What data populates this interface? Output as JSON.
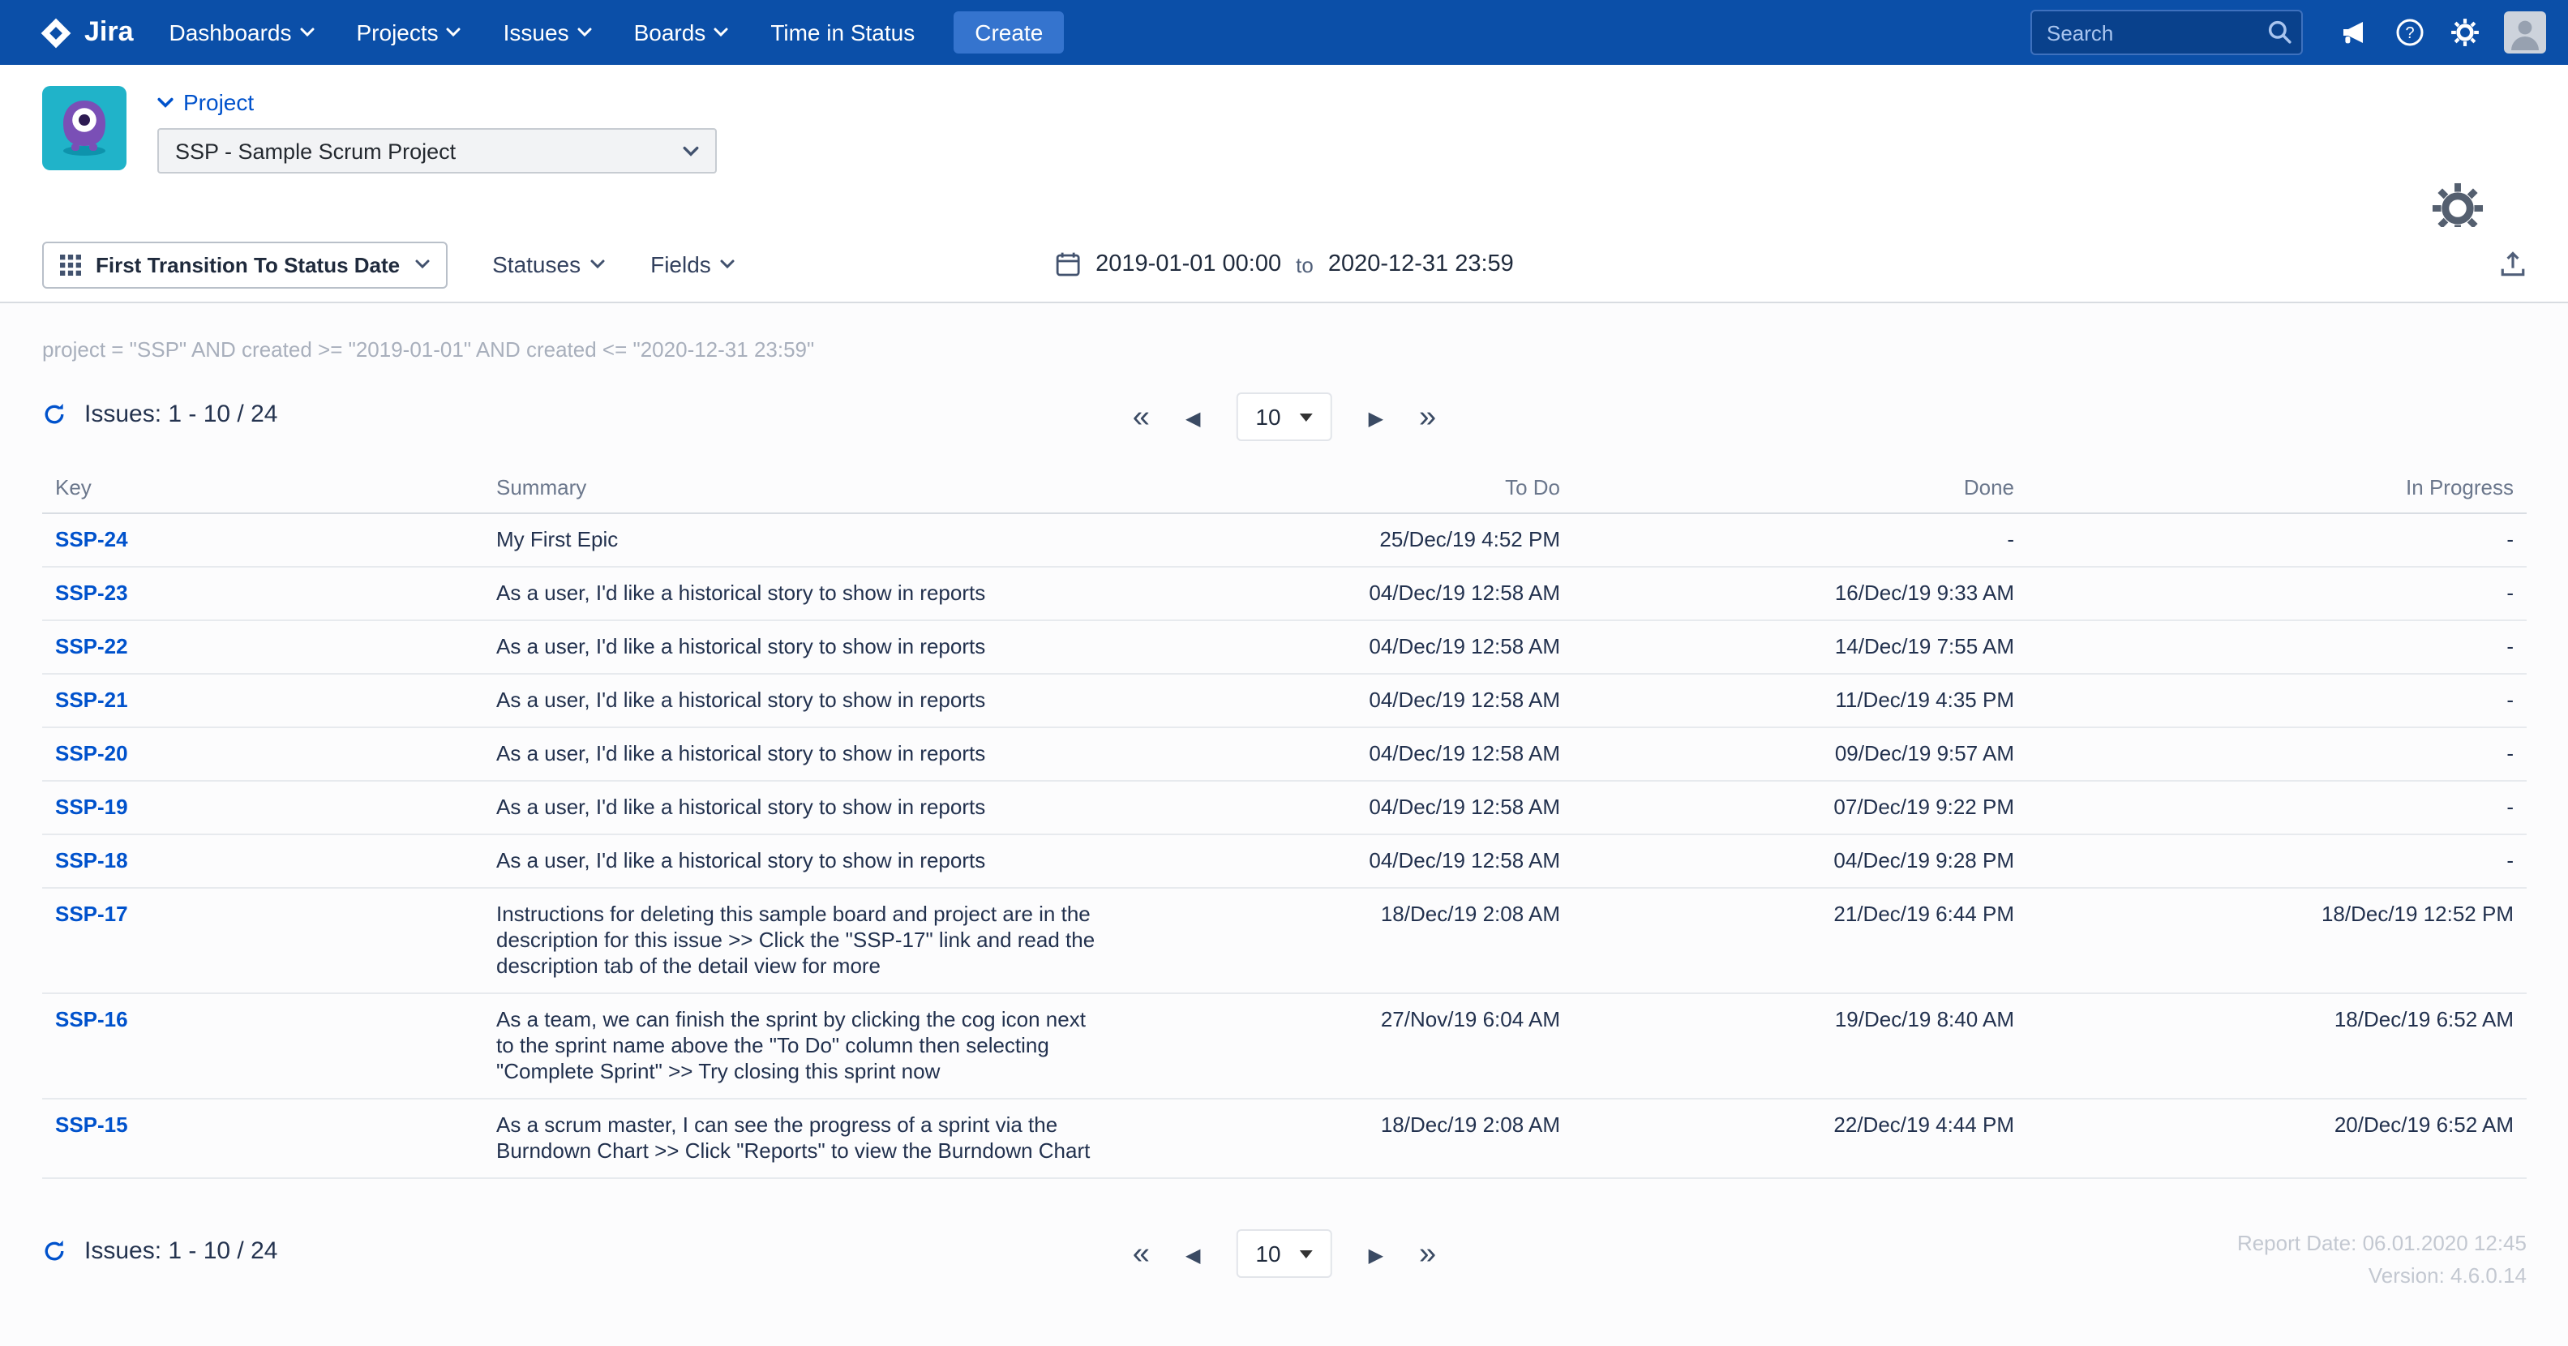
{
  "colors": {
    "navbar": "#0B4FA8",
    "accent_link": "#0052CC",
    "create_button": "#3574CE",
    "project_avatar_teal": "#20B3C9",
    "project_avatar_purple": "#7A4FB6"
  },
  "navbar": {
    "brand": "Jira",
    "menu": [
      "Dashboards",
      "Projects",
      "Issues",
      "Boards",
      "Time in Status"
    ],
    "create_label": "Create",
    "search_placeholder": "Search"
  },
  "header": {
    "project_label": "Project",
    "project_select_value": "SSP - Sample Scrum Project"
  },
  "toolbar": {
    "report_type": "First Transition To Status Date",
    "statuses_label": "Statuses",
    "fields_label": "Fields",
    "date_from": "2019-01-01 00:00",
    "date_to_word": "to",
    "date_to": "2020-12-31 23:59"
  },
  "query": "project = \"SSP\" AND created >= \"2019-01-01\" AND created <= \"2020-12-31 23:59\"",
  "pagination": {
    "issues_label": "Issues: 1 - 10 / 24",
    "page_size": "10"
  },
  "icons": {
    "first_page": "«",
    "prev_page": "◀",
    "next_page": "▶",
    "last_page": "»"
  },
  "table": {
    "columns": [
      "Key",
      "Summary",
      "To Do",
      "Done",
      "In Progress"
    ],
    "rows": [
      {
        "key": "SSP-24",
        "summary": "My First Epic",
        "todo": "25/Dec/19 4:52 PM",
        "done": "-",
        "inprogress": "-"
      },
      {
        "key": "SSP-23",
        "summary": "As a user, I'd like a historical story to show in reports",
        "todo": "04/Dec/19 12:58 AM",
        "done": "16/Dec/19 9:33 AM",
        "inprogress": "-"
      },
      {
        "key": "SSP-22",
        "summary": "As a user, I'd like a historical story to show in reports",
        "todo": "04/Dec/19 12:58 AM",
        "done": "14/Dec/19 7:55 AM",
        "inprogress": "-"
      },
      {
        "key": "SSP-21",
        "summary": "As a user, I'd like a historical story to show in reports",
        "todo": "04/Dec/19 12:58 AM",
        "done": "11/Dec/19 4:35 PM",
        "inprogress": "-"
      },
      {
        "key": "SSP-20",
        "summary": "As a user, I'd like a historical story to show in reports",
        "todo": "04/Dec/19 12:58 AM",
        "done": "09/Dec/19 9:57 AM",
        "inprogress": "-"
      },
      {
        "key": "SSP-19",
        "summary": "As a user, I'd like a historical story to show in reports",
        "todo": "04/Dec/19 12:58 AM",
        "done": "07/Dec/19 9:22 PM",
        "inprogress": "-"
      },
      {
        "key": "SSP-18",
        "summary": "As a user, I'd like a historical story to show in reports",
        "todo": "04/Dec/19 12:58 AM",
        "done": "04/Dec/19 9:28 PM",
        "inprogress": "-"
      },
      {
        "key": "SSP-17",
        "summary": "Instructions for deleting this sample board and project are in the description for this issue >> Click the \"SSP-17\" link and read the description tab of the detail view for more",
        "todo": "18/Dec/19 2:08 AM",
        "done": "21/Dec/19 6:44 PM",
        "inprogress": "18/Dec/19 12:52 PM"
      },
      {
        "key": "SSP-16",
        "summary": "As a team, we can finish the sprint by clicking the cog icon next to the sprint name above the \"To Do\" column then selecting \"Complete Sprint\" >> Try closing this sprint now",
        "todo": "27/Nov/19 6:04 AM",
        "done": "19/Dec/19 8:40 AM",
        "inprogress": "18/Dec/19 6:52 AM"
      },
      {
        "key": "SSP-15",
        "summary": "As a scrum master, I can see the progress of a sprint via the Burndown Chart >> Click \"Reports\" to view the Burndown Chart",
        "todo": "18/Dec/19 2:08 AM",
        "done": "22/Dec/19 4:44 PM",
        "inprogress": "20/Dec/19 6:52 AM"
      }
    ]
  },
  "footer": {
    "report_date": "Report Date: 06.01.2020 12:45",
    "version": "Version: 4.6.0.14"
  }
}
